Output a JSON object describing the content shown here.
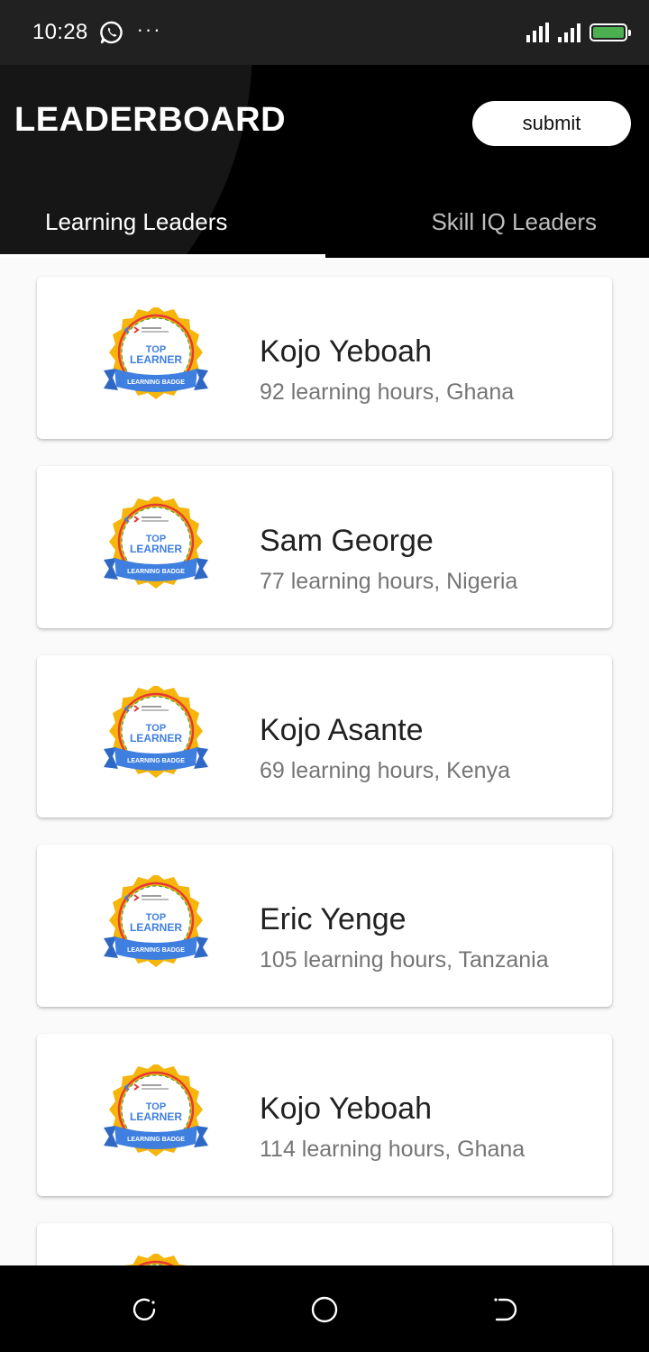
{
  "status_bar": {
    "time": "10:28",
    "more": "···"
  },
  "app_bar": {
    "title": "LEADERBOARD",
    "submit_label": "submit"
  },
  "tabs": [
    {
      "label": "Learning Leaders"
    },
    {
      "label": "Skill IQ Leaders"
    }
  ],
  "badge": {
    "line1": "TOP",
    "line2": "LEARNER",
    "ribbon": "LEARNING BADGE"
  },
  "leaders": [
    {
      "name": "Kojo Yeboah",
      "detail": "92 learning hours, Ghana"
    },
    {
      "name": "Sam George",
      "detail": "77 learning hours, Nigeria"
    },
    {
      "name": "Kojo Asante",
      "detail": "69 learning hours, Kenya"
    },
    {
      "name": "Eric Yenge",
      "detail": "105 learning hours, Tanzania"
    },
    {
      "name": "Kojo Yeboah",
      "detail": "114 learning hours, Ghana"
    },
    {
      "name": "",
      "detail": ""
    }
  ],
  "colors": {
    "badge_gold": "#F5B50A",
    "badge_blue": "#3F7FE0",
    "badge_red": "#E53935",
    "badge_green": "#43A047",
    "text_primary": "#212121",
    "text_secondary": "#757575"
  },
  "icons": {
    "whatsapp": "whatsapp-icon",
    "recent_apps": "recent-apps-icon",
    "home": "home-icon",
    "back": "back-icon"
  }
}
